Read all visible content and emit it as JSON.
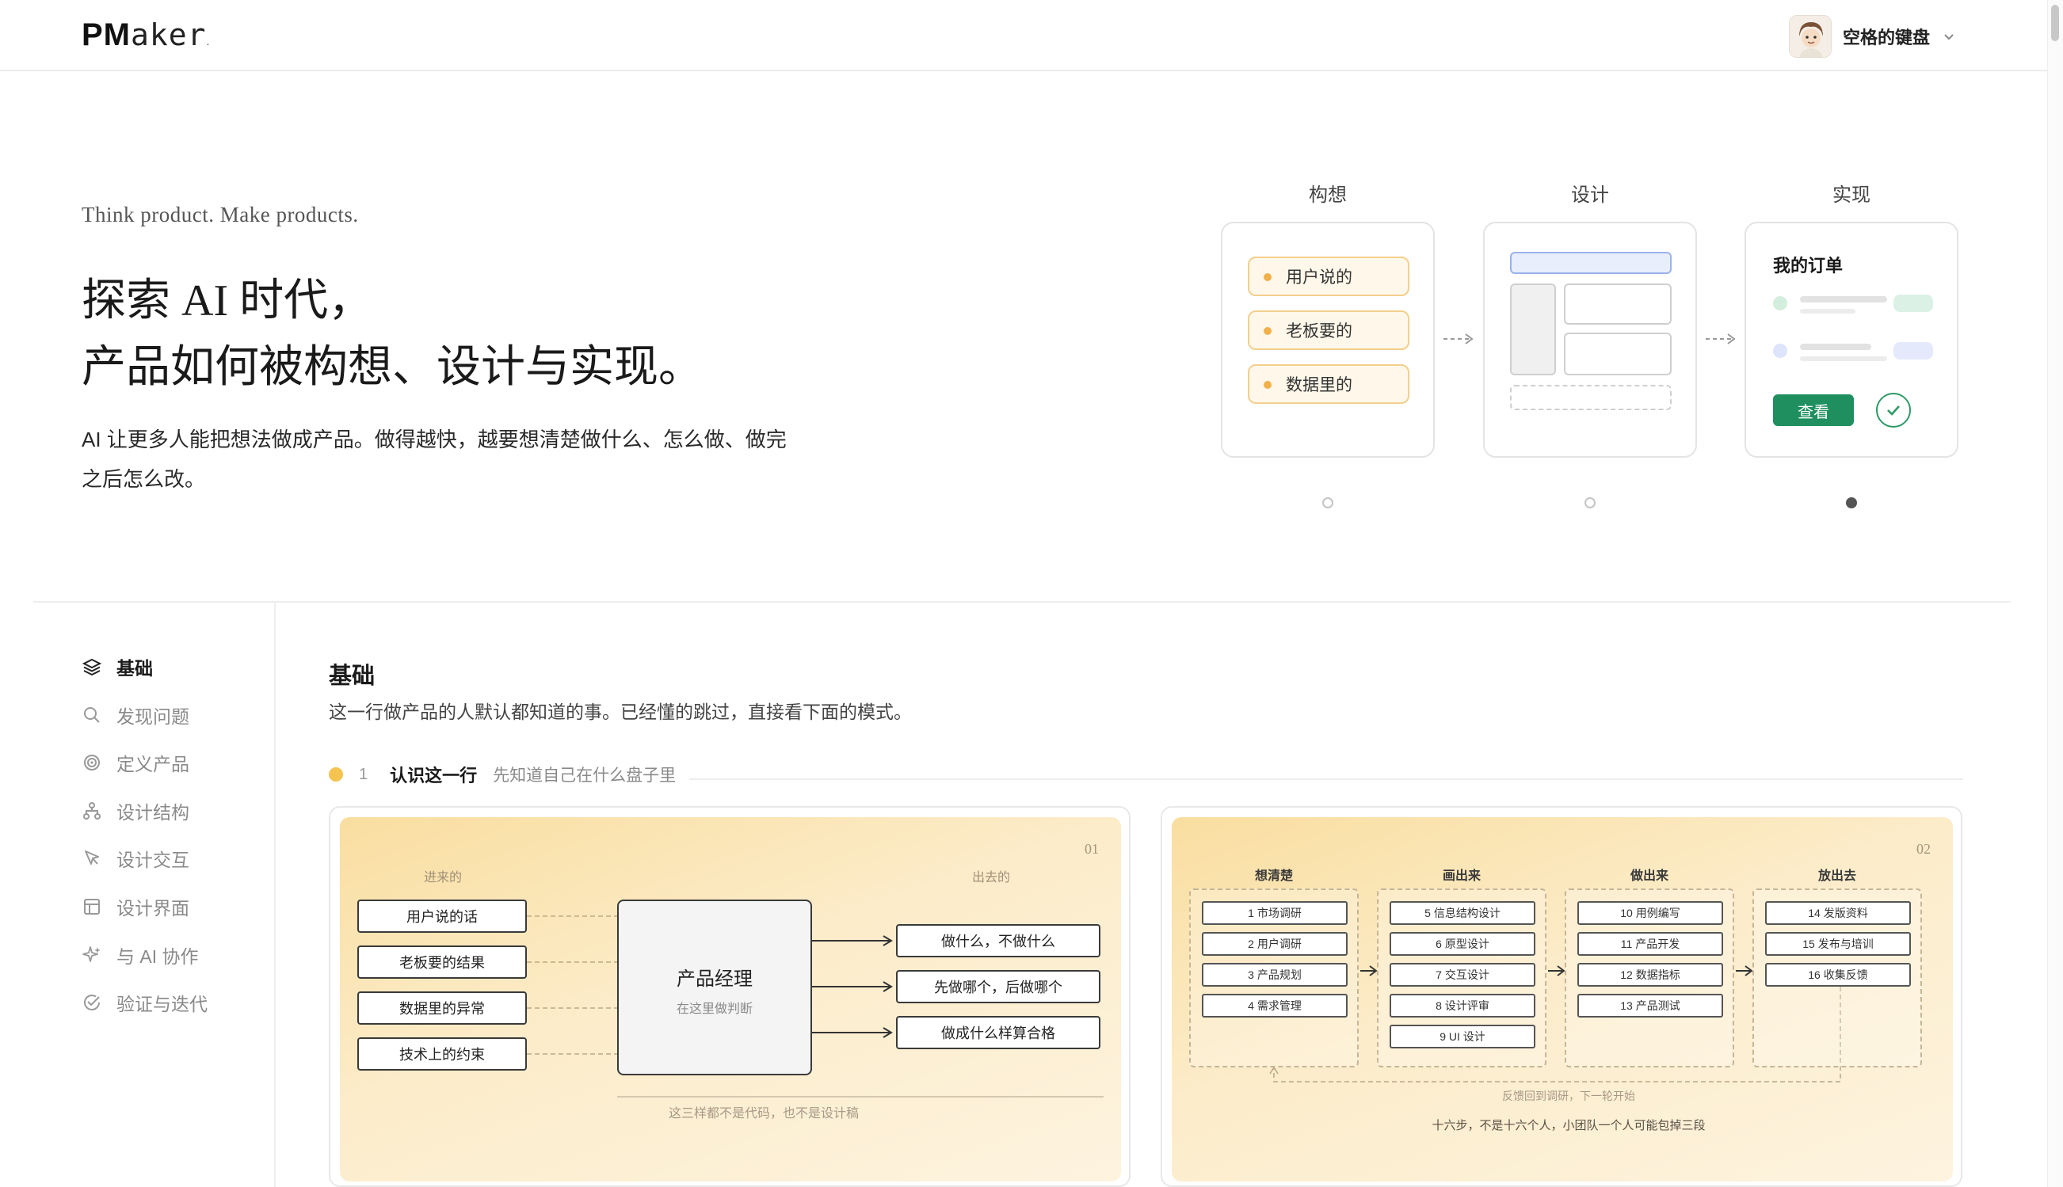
{
  "header": {
    "logo_pm": "PM",
    "logo_aker": "aker",
    "logo_dot": ".",
    "username": "空格的键盘"
  },
  "hero": {
    "tagline": "Think product. Make products.",
    "title_line1": "探索 AI 时代，",
    "title_line2": "产品如何被构想、设计与实现。",
    "description": "AI 让更多人能把想法做成产品。做得越快，越要想清楚做什么、怎么做、做完之后怎么改。"
  },
  "flow": {
    "stages": [
      "构想",
      "设计",
      "实现"
    ],
    "ideation_items": [
      "用户说的",
      "老板要的",
      "数据里的"
    ],
    "order_title": "我的订单",
    "view_button": "查看",
    "active_dot": 2
  },
  "sidebar": {
    "items": [
      {
        "label": "基础",
        "icon": "layers-icon",
        "active": true
      },
      {
        "label": "发现问题",
        "icon": "search-icon",
        "active": false
      },
      {
        "label": "定义产品",
        "icon": "target-icon",
        "active": false
      },
      {
        "label": "设计结构",
        "icon": "structure-icon",
        "active": false
      },
      {
        "label": "设计交互",
        "icon": "cursor-icon",
        "active": false
      },
      {
        "label": "设计界面",
        "icon": "layout-icon",
        "active": false
      },
      {
        "label": "与 AI 协作",
        "icon": "sparkle-icon",
        "active": false
      },
      {
        "label": "验证与迭代",
        "icon": "check-circle-icon",
        "active": false
      }
    ]
  },
  "content": {
    "title": "基础",
    "description": "这一行做产品的人默认都知道的事。已经懂的跳过，直接看下面的模式。",
    "step": {
      "number": "1",
      "title": "认识这一行",
      "subtitle": "先知道自己在什么盘子里"
    }
  },
  "panel1": {
    "number": "01",
    "in_label": "进来的",
    "out_label": "出去的",
    "inputs": [
      "用户说的话",
      "老板要的结果",
      "数据里的异常",
      "技术上的约束"
    ],
    "center_title": "产品经理",
    "center_sub": "在这里做判断",
    "outputs": [
      "做什么，不做什么",
      "先做哪个，后做哪个",
      "做成什么样算合格"
    ],
    "caption": "这三样都不是代码，也不是设计稿"
  },
  "panel2": {
    "number": "02",
    "columns": [
      {
        "title": "想清楚",
        "items": [
          "1 市场调研",
          "2 用户调研",
          "3 产品规划",
          "4 需求管理"
        ]
      },
      {
        "title": "画出来",
        "items": [
          "5 信息结构设计",
          "6 原型设计",
          "7 交互设计",
          "8 设计评审",
          "9 UI 设计"
        ]
      },
      {
        "title": "做出来",
        "items": [
          "10 用例编写",
          "11 产品开发",
          "12 数据指标",
          "13 产品测试"
        ]
      },
      {
        "title": "放出去",
        "items": [
          "14 发版资料",
          "15 发布与培训",
          "16 收集反馈"
        ]
      }
    ],
    "feedback_label": "反馈回到调研，下一轮开始",
    "caption": "十六步，不是十六个人，小团队一个人可能包掉三段"
  },
  "colors": {
    "accent_green": "#1f8f5f",
    "accent_yellow": "#f5c34f",
    "pill_border": "#f3cf8c"
  }
}
